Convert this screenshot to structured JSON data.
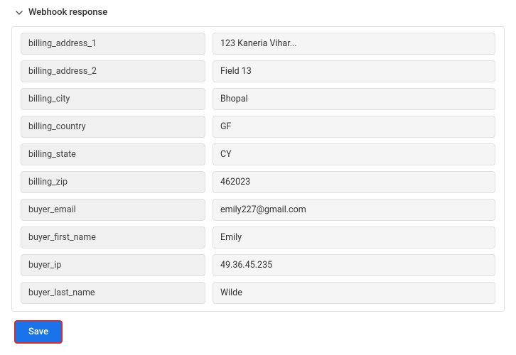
{
  "section": {
    "title": "Webhook response",
    "chevron": "▾"
  },
  "fields": [
    {
      "key": "billing_address_2",
      "value": "Field 13"
    },
    {
      "key": "billing_city",
      "value": "Bhopal"
    },
    {
      "key": "billing_country",
      "value": "GF"
    },
    {
      "key": "billing_state",
      "value": "CY"
    },
    {
      "key": "billing_zip",
      "value": "462023"
    },
    {
      "key": "buyer_email",
      "value": "emily227@gmail.com"
    },
    {
      "key": "buyer_first_name",
      "value": "Emily"
    },
    {
      "key": "buyer_ip",
      "value": "49.36.45.235"
    },
    {
      "key": "buyer_last_name",
      "value": "Wilde"
    }
  ],
  "top_row": {
    "key": "billing_address_1",
    "value": "123 Kaneria Vihar..."
  },
  "buttons": {
    "save": "Save"
  }
}
